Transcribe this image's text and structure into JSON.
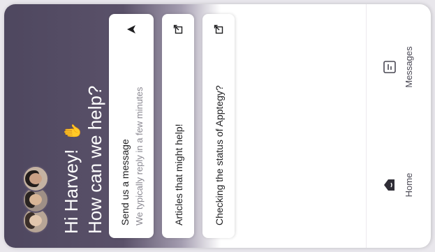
{
  "hero": {
    "greeting_line1": "Hi Harvey!",
    "greeting_line2": "How can we help?",
    "wave_icon": "waving-hand-icon"
  },
  "cards": [
    {
      "title": "Send us a message",
      "subtitle": "We typically reply in a few minutes",
      "icon": "send-icon"
    },
    {
      "title": "Articles that might help!",
      "icon": "external-link-icon"
    },
    {
      "title": "Checking the status of Apptegy?",
      "icon": "external-link-icon"
    }
  ],
  "nav": {
    "home_label": "Home",
    "messages_label": "Messages"
  },
  "colors": {
    "hero": "#5a5169",
    "accent": "#f3c03c"
  }
}
